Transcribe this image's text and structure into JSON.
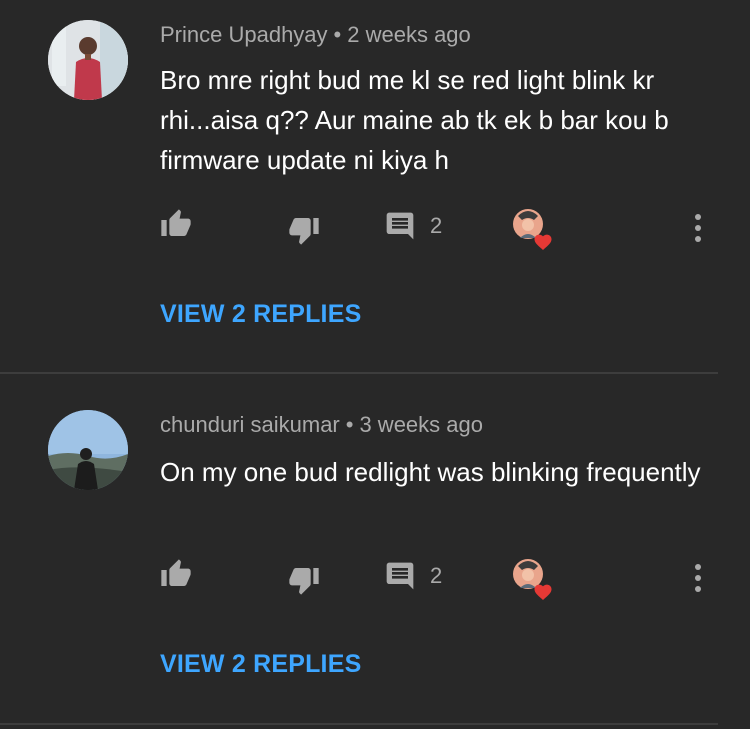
{
  "comments": [
    {
      "author": "Prince Upadhyay",
      "time": "2 weeks ago",
      "text": "Bro mre right bud me kl se red light blink kr rhi...aisa q?? Aur maine ab tk ek b bar kou b firmware update ni kiya h",
      "reply_count": "2",
      "view_replies": "VIEW 2 REPLIES"
    },
    {
      "author": "chunduri saikumar",
      "time": "3 weeks ago",
      "text": "On my one bud redlight was blinking frequently",
      "reply_count": "2",
      "view_replies": "VIEW 2 REPLIES"
    }
  ],
  "separator": "•",
  "colors": {
    "background": "#282828",
    "meta_text": "#aaaaaa",
    "link": "#3ea6ff",
    "heart": "#e53935"
  },
  "icons": [
    "like-icon",
    "dislike-icon",
    "reply-icon",
    "creator-heart-icon",
    "more-vert-icon"
  ]
}
